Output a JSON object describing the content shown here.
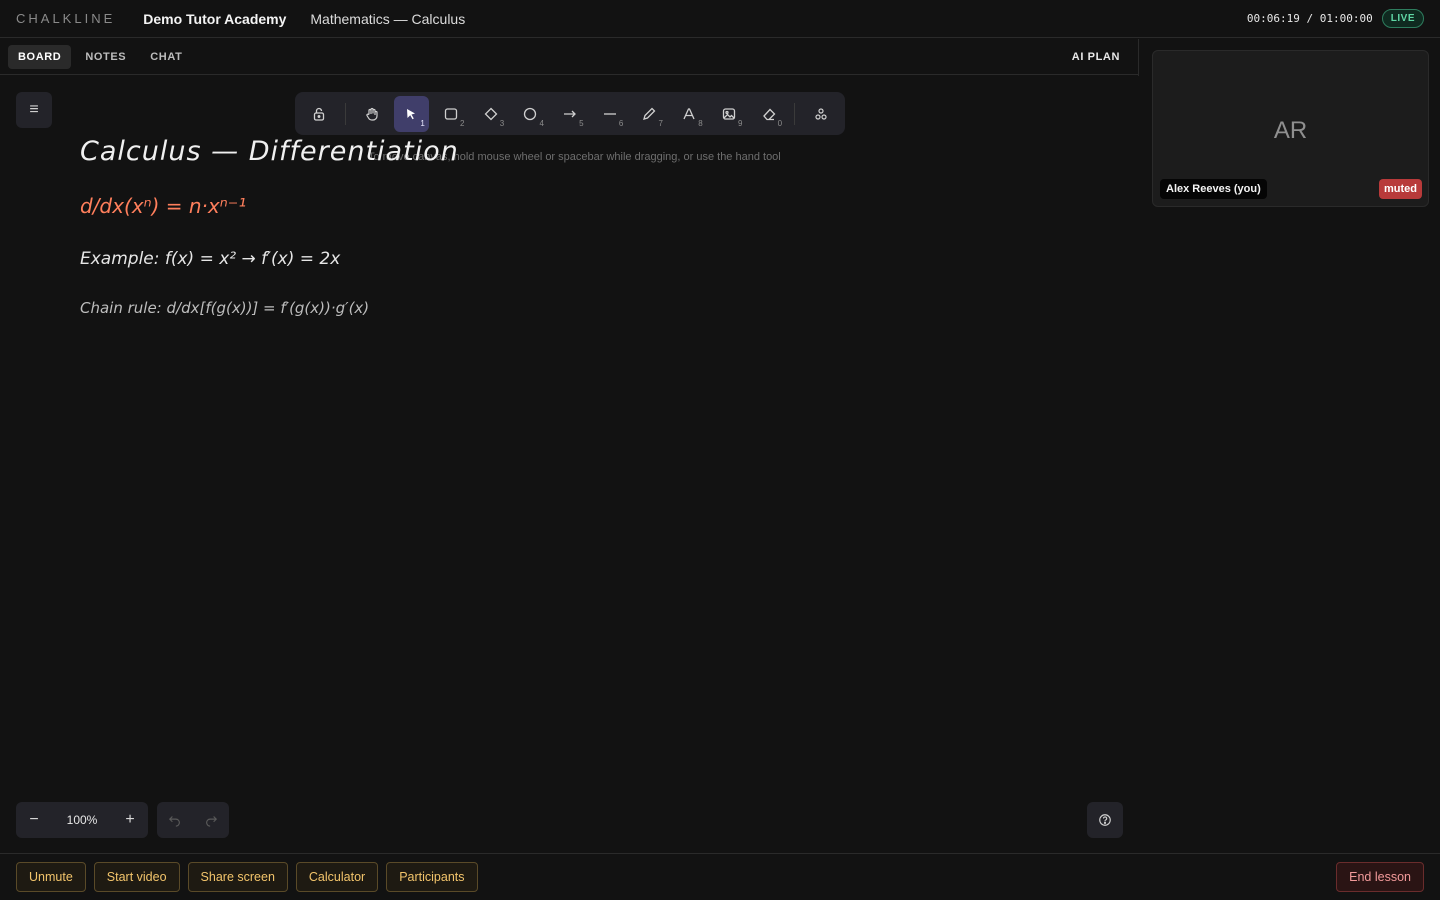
{
  "header": {
    "brand": "CHALKLINE",
    "academy": "Demo Tutor Academy",
    "subject": "Mathematics — Calculus",
    "timer": "00:06:19 / 01:00:00",
    "live_badge": "LIVE"
  },
  "tabs": [
    {
      "label": "BOARD",
      "active": true
    },
    {
      "label": "NOTES",
      "active": false
    },
    {
      "label": "CHAT",
      "active": false
    }
  ],
  "ai_plan_label": "AI PLAN",
  "toolbar": {
    "tools": [
      {
        "name": "lock-icon",
        "key": ""
      },
      {
        "name": "hand-icon",
        "key": ""
      },
      {
        "name": "pointer-icon",
        "key": "1",
        "active": true
      },
      {
        "name": "rectangle-icon",
        "key": "2"
      },
      {
        "name": "diamond-icon",
        "key": "3"
      },
      {
        "name": "ellipse-icon",
        "key": "4"
      },
      {
        "name": "arrow-icon",
        "key": "5"
      },
      {
        "name": "line-icon",
        "key": "6"
      },
      {
        "name": "pencil-icon",
        "key": "7"
      },
      {
        "name": "text-icon",
        "key": "8"
      },
      {
        "name": "image-icon",
        "key": "9"
      },
      {
        "name": "eraser-icon",
        "key": "0"
      },
      {
        "name": "shapes-library-icon",
        "key": ""
      }
    ]
  },
  "canvas": {
    "hint": "To move canvas, hold mouse wheel or spacebar while dragging, or use the hand tool",
    "title": "Calculus — Differentiation",
    "power_rule": "d/dx(xⁿ) = n·xⁿ⁻¹",
    "example": "Example:  f(x) = x²  →  f′(x) = 2x",
    "chain_rule": "Chain rule:  d/dx[f(g(x))] = f′(g(x))·g′(x)",
    "formula_color": "#ff7f5c"
  },
  "zoom": {
    "level": "100%",
    "minus": "−",
    "plus": "+"
  },
  "participant": {
    "initials": "AR",
    "name": "Alex Reeves (you)",
    "status": "muted"
  },
  "bottom_actions": [
    "Unmute",
    "Start video",
    "Share screen",
    "Calculator",
    "Participants"
  ],
  "end_lesson": "End lesson"
}
